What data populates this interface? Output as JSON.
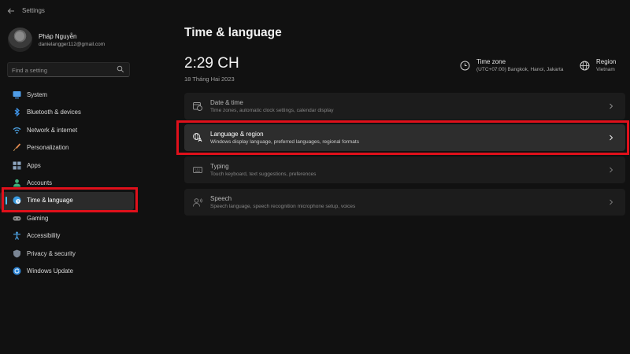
{
  "window": {
    "title": "Settings",
    "back_icon": "back-arrow-icon"
  },
  "user": {
    "name": "Pháp Nguyễn",
    "email": "danielangger112@gmail.com"
  },
  "search": {
    "placeholder": "Find a setting",
    "icon": "search-icon"
  },
  "sidebar": {
    "items": [
      {
        "label": "System",
        "icon": "monitor-icon"
      },
      {
        "label": "Bluetooth & devices",
        "icon": "bluetooth-icon"
      },
      {
        "label": "Network & internet",
        "icon": "wifi-icon"
      },
      {
        "label": "Personalization",
        "icon": "brush-icon"
      },
      {
        "label": "Apps",
        "icon": "apps-icon"
      },
      {
        "label": "Accounts",
        "icon": "person-icon"
      },
      {
        "label": "Time & language",
        "icon": "globe-clock-icon"
      },
      {
        "label": "Gaming",
        "icon": "gamepad-icon"
      },
      {
        "label": "Accessibility",
        "icon": "accessibility-icon"
      },
      {
        "label": "Privacy & security",
        "icon": "shield-icon"
      },
      {
        "label": "Windows Update",
        "icon": "update-icon"
      }
    ],
    "active": "Time & language"
  },
  "main": {
    "title": "Time & language",
    "clock": "2:29 CH",
    "date": "18 Tháng Hai 2023",
    "time_zone": {
      "title": "Time zone",
      "value": "(UTC+07:00) Bangkok, Hanoi, Jakarta",
      "icon": "globe-clock-icon"
    },
    "region": {
      "title": "Region",
      "value": "Vietnam",
      "icon": "globe-icon"
    },
    "cards": [
      {
        "title": "Date & time",
        "desc": "Time zones, automatic clock settings, calendar display",
        "icon": "calendar-clock-icon"
      },
      {
        "title": "Language & region",
        "desc": "Windows display language, preferred languages, regional formats",
        "icon": "language-icon"
      },
      {
        "title": "Typing",
        "desc": "Touch keyboard, text suggestions, preferences",
        "icon": "keyboard-icon"
      },
      {
        "title": "Speech",
        "desc": "Speech language, speech recognition microphone setup, voices",
        "icon": "speech-icon"
      }
    ]
  },
  "colors": {
    "accent": "#4cc2ff",
    "highlight_box": "#e0101b",
    "background": "#111111",
    "card": "#1c1c1c"
  }
}
